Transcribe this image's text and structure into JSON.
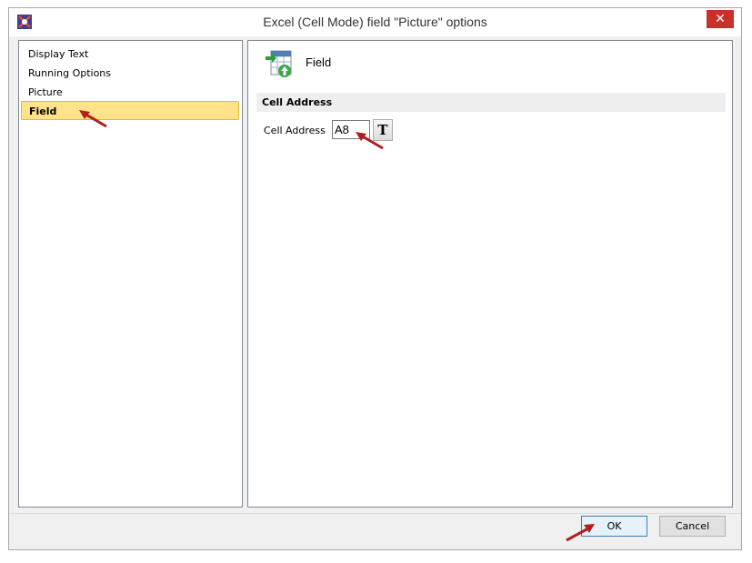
{
  "window": {
    "title": "Excel (Cell Mode) field \"Picture\" options",
    "close_label": "✕"
  },
  "nav": {
    "items": [
      {
        "label": "Display Text"
      },
      {
        "label": "Running Options"
      },
      {
        "label": "Picture"
      },
      {
        "label": "Field"
      }
    ],
    "selected": "Field"
  },
  "panel": {
    "title": "Field",
    "section_title": "Cell Address",
    "cell_address_label": "Cell Address",
    "cell_address_value": "A8",
    "text_button_label": "T"
  },
  "footer": {
    "ok_label": "OK",
    "cancel_label": "Cancel"
  },
  "colors": {
    "selection": "#ffe28a",
    "close": "#c7312a",
    "annotation_arrow": "#b21f1f"
  }
}
